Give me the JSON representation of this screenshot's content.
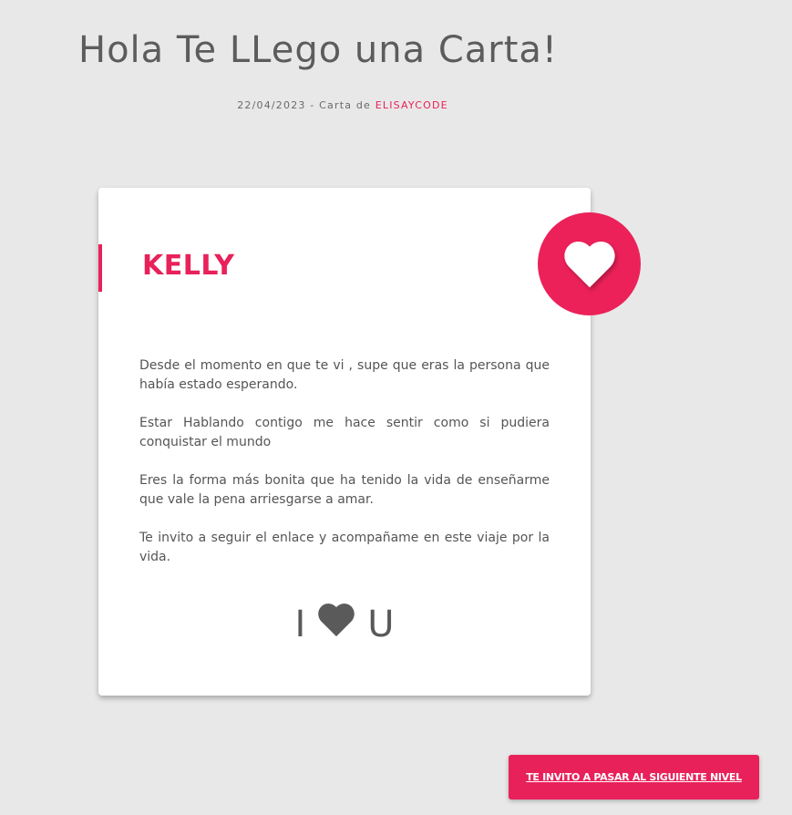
{
  "header": {
    "title": "Hola Te LLego una Carta!",
    "date": "22/04/2023",
    "by_prefix": " - Carta de ",
    "author": "ELISAYCODE"
  },
  "card": {
    "recipient": "KELLY",
    "badge_icon": "heart-icon",
    "paragraphs": [
      "Desde el momento en que te vi , supe que eras la persona que había estado esperando.",
      "Estar Hablando contigo me hace sentir como si pudiera conquistar el mundo",
      "Eres la forma más bonita que ha tenido la vida de enseñarme que vale la pena arriesgarse a amar.",
      "Te invito a seguir el enlace y acompañame en este viaje por la vida."
    ],
    "signoff_left": "I",
    "signoff_icon": "heart-icon",
    "signoff_right": "U"
  },
  "cta": {
    "label": "TE INVITO A PASAR AL SIGUIENTE NIVEL"
  },
  "colors": {
    "background": "#e8e8e8",
    "accent": "#e8215a",
    "text": "#5c5c5c",
    "card": "#ffffff"
  }
}
